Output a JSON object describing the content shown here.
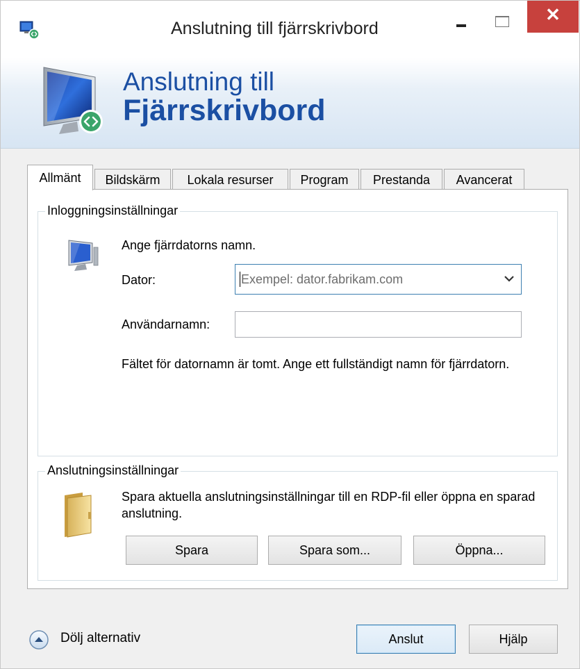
{
  "window": {
    "title": "Anslutning till fjärrskrivbord",
    "close_glyph": "✕"
  },
  "banner": {
    "line1": "Anslutning till",
    "line2": "Fjärrskrivbord"
  },
  "tabs": [
    {
      "label": "Allmänt",
      "active": true
    },
    {
      "label": "Bildskärm",
      "active": false
    },
    {
      "label": "Lokala resurser",
      "active": false
    },
    {
      "label": "Program",
      "active": false
    },
    {
      "label": "Prestanda",
      "active": false
    },
    {
      "label": "Avancerat",
      "active": false
    }
  ],
  "login_settings": {
    "legend": "Inloggningsinställningar",
    "prompt": "Ange fjärrdatorns namn.",
    "computer_label": "Dator:",
    "computer_placeholder": "Exempel: dator.fabrikam.com",
    "computer_value": "",
    "username_label": "Användarnamn:",
    "username_value": "",
    "warning": "Fältet för datornamn är tomt. Ange ett fullständigt namn för fjärrdatorn."
  },
  "connection_settings": {
    "legend": "Anslutningsinställningar",
    "description": "Spara aktuella anslutningsinställningar till en RDP-fil eller öppna en sparad anslutning.",
    "save_label": "Spara",
    "save_as_label": "Spara som...",
    "open_label": "Öppna..."
  },
  "footer": {
    "toggle_label": "Dölj alternativ",
    "connect_label": "Anslut",
    "help_label": "Hjälp"
  },
  "icons": {
    "app": "remote-desktop-icon",
    "banner": "remote-desktop-monitor-icon",
    "computer": "computer-monitor-icon",
    "folder": "folder-icon",
    "toggle": "chevron-up-circle-icon",
    "combo_arrow": "chevron-down-icon"
  },
  "colors": {
    "banner_text": "#1b4fa3",
    "close_button": "#c7413d",
    "focus_border": "#3c7fb1"
  }
}
